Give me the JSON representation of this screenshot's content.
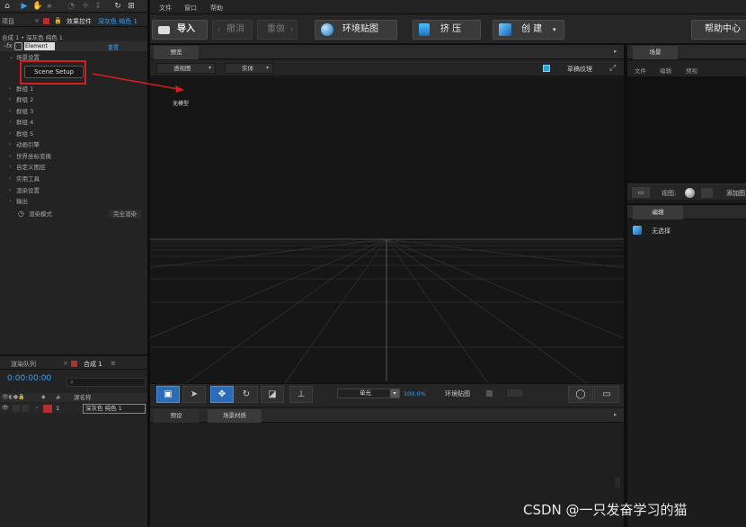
{
  "left_panel": {
    "tab_project": "项目",
    "tab_effects": "效果控件",
    "tab_effects_layer": "深灰色 纯色 1",
    "comp_path": "合成 1 • 深灰色 纯色 1",
    "effect_name": "Element",
    "reset_label": "重置",
    "scene_settings": "场景设置",
    "scene_setup_button": "Scene Setup",
    "groups": [
      "群组 1",
      "群组 2",
      "群组 3",
      "群组 4",
      "群组 5"
    ],
    "items": [
      "动画引擎",
      "世界坐标变换",
      "自定义图层",
      "实用工具",
      "渲染设置",
      "输出"
    ],
    "render_mode_label": "渲染模式",
    "render_mode_value": "完全渲染",
    "render_queue_tab": "渲染队列",
    "comp_tab": "合成 1",
    "timecode": "0:00:00:00",
    "layer_header_num": "#",
    "layer_header_name": "源名称",
    "layer_num": "1",
    "layer_name": "深灰色 纯色 1"
  },
  "menubar": [
    "文件",
    "窗口",
    "帮助"
  ],
  "toolbar": {
    "import": "导入",
    "undo": "撤消",
    "redo": "重做",
    "env_map": "环境贴图",
    "extrude": "挤 压",
    "create": "创 建",
    "help": "帮助中心"
  },
  "viewport": {
    "tab": "预览",
    "camera_dropdown": "透视图",
    "render_dropdown": "实体",
    "draft_texture": "草稿纹理",
    "no_model": "无模型",
    "light_dropdown": "单光",
    "zoom_pct": "100.0%",
    "env_map_label": "环境贴图"
  },
  "bottom_panel": {
    "tab_presets": "预设",
    "tab_scene_materials": "场景材质"
  },
  "scene_panel": {
    "tab": "场景",
    "menu": [
      "文件",
      "编辑",
      "预视"
    ],
    "view_label": "视图:",
    "add_label": "添加图"
  },
  "edit_panel": {
    "tab": "编辑",
    "no_selection": "无选择"
  },
  "watermark": "CSDN @一只发奋学习的猫",
  "colors": {
    "accent_blue": "#3ea0f0",
    "highlight_red": "#d21f1f"
  }
}
